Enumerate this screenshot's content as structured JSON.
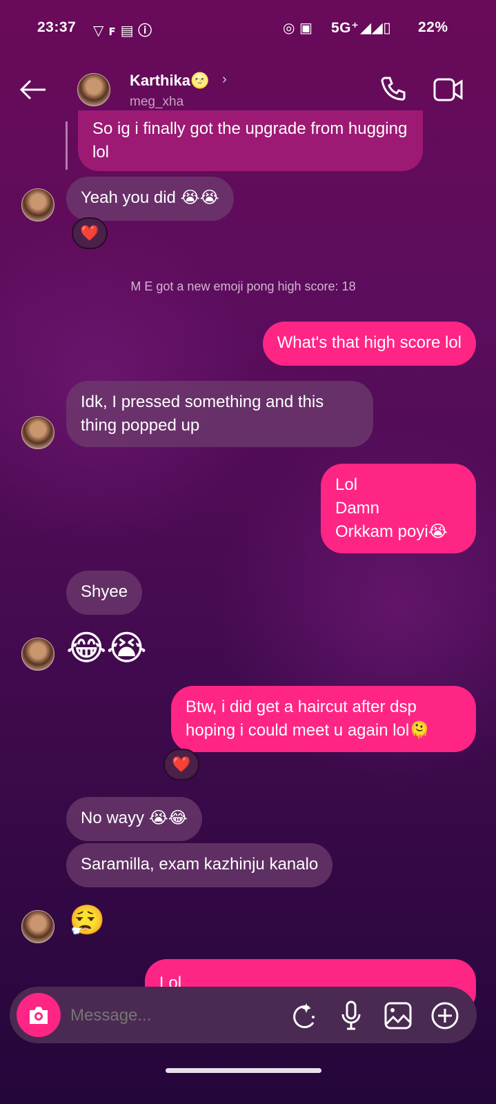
{
  "status_bar": {
    "time": "23:37",
    "network": "5G⁺",
    "battery": "22%"
  },
  "header": {
    "name": "Karthika🌝",
    "username": "meg_xha"
  },
  "messages": {
    "quoted": "So ig i finally got the upgrade from hugging\nlol",
    "m1": "Yeah you did 😭😭",
    "reaction": "❤️",
    "system": "M E got a new emoji pong high score: 18",
    "m2": "What's that high score lol",
    "m3": "Idk, I pressed something and this\nthing popped up",
    "m4": "Lol\nDamn\nOrkkam poyi😭",
    "m5": "Shyee",
    "m6": "😂😭",
    "m7": "Btw, i did get a haircut after dsp\nhoping i could meet u again lol🫠",
    "m8": "No wayy 😭😂",
    "m9": "Saramilla, exam kazhinju kanalo",
    "m10": "😮‍💨",
    "m11": "Lol"
  },
  "composer": {
    "placeholder": "Message..."
  },
  "colors": {
    "sent": "#ff2585",
    "received": "#6e3c6e",
    "accent": "#ff2585"
  }
}
